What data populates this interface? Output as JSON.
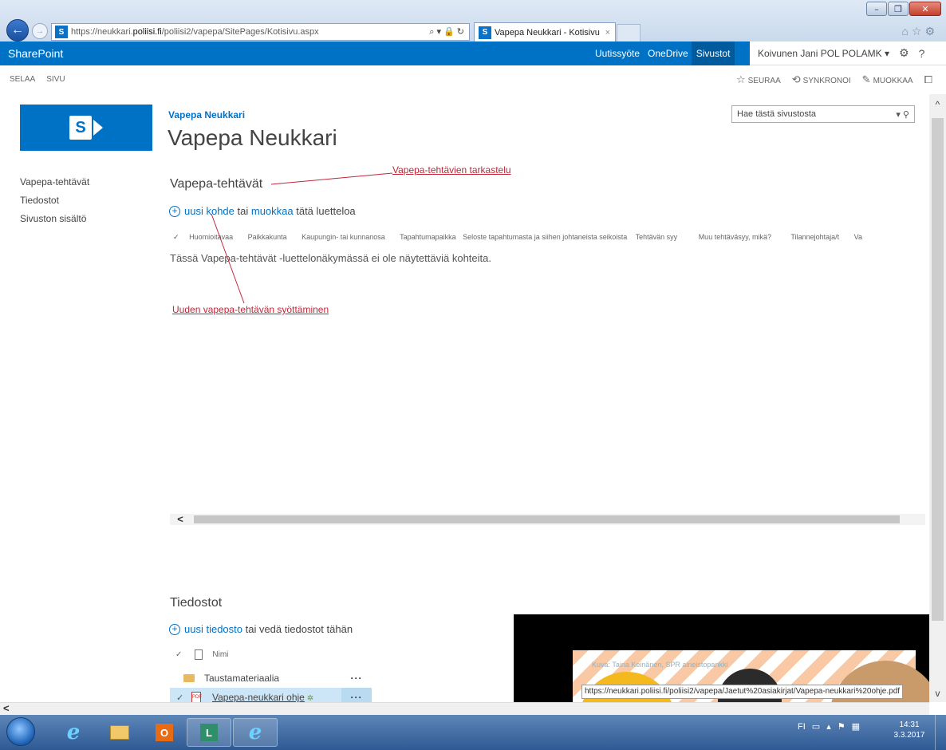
{
  "browser": {
    "url_prefix": "https://neukkari.",
    "url_domain": "poliisi.fi",
    "url_path": "/poliisi2/vapepa/SitePages/Kotisivu.aspx",
    "addr_icons": "⌕ ▾ 🔒 ↻",
    "tab_title": "Vapepa Neukkari - Kotisivu",
    "tab_close": "×",
    "tools": "⌂☆⚙",
    "win_min": "–",
    "win_max": "❐",
    "win_close": "✕"
  },
  "suite": {
    "brand": "SharePoint",
    "links": [
      "Uutissyöte",
      "OneDrive",
      "Sivustot"
    ],
    "user": "Koivunen Jani POL POLAMK ▾",
    "settings_icon": "⚙",
    "help_icon": "?"
  },
  "ribbon": {
    "tabs": [
      "SELAA",
      "SIVU"
    ],
    "follow": "SEURAA",
    "sync": "SYNKRONOI",
    "edit": "MUOKKAA",
    "focus_icon": "⧠"
  },
  "site": {
    "breadcrumb": "Vapepa Neukkari",
    "title": "Vapepa Neukkari",
    "search_placeholder": "Hae tästä sivustosta",
    "search_icons": "▾ ⚲"
  },
  "left_nav": [
    "Vapepa-tehtävät",
    "Tiedostot",
    "Sivuston sisältö"
  ],
  "list": {
    "title": "Vapepa-tehtävät",
    "new_item": "uusi kohde",
    "or": " tai ",
    "edit": "muokkaa",
    "rest": " tätä luetteloa",
    "columns": [
      "Huomioitavaa",
      "Paikkakunta",
      "Kaupungin- tai kunnanosa",
      "Tapahtumapaikka",
      "Seloste tapahtumasta ja siihen johtaneista seikoista",
      "Tehtävän syy",
      "Muu tehtäväsyy, mikä?",
      "Tilannejohtaja/t",
      "Va"
    ],
    "empty_message": "Tässä Vapepa-tehtävät -luettelonäkymässä ei ole näytettäviä kohteita."
  },
  "annotations": {
    "view": "Vapepa-tehtävien tarkastelu",
    "new": "Uuden vapepa-tehtävän syöttäminen"
  },
  "files": {
    "title": "Tiedostot",
    "new_file": "uusi tiedosto",
    "drag_text": " tai vedä tiedostot tähän",
    "name_header": "Nimi",
    "rows": [
      {
        "name": "Taustamateriaalia",
        "type": "folder"
      },
      {
        "name": "Vapepa-neukkari ohje",
        "type": "pdf"
      }
    ]
  },
  "image": {
    "caption": "Kuva: Taina Keinänen, SPR aineistopankki"
  },
  "status_url": "https://neukkari.poliisi.fi/poliisi2/vapepa/Jaetut%20asiakirjat/Vapepa-neukkari%20ohje.pdf",
  "tray": {
    "lang": "FI",
    "time": "14:31",
    "date": "3.3.2017"
  },
  "colors": {
    "accent": "#0072c6",
    "annotation": "#c0283a"
  }
}
